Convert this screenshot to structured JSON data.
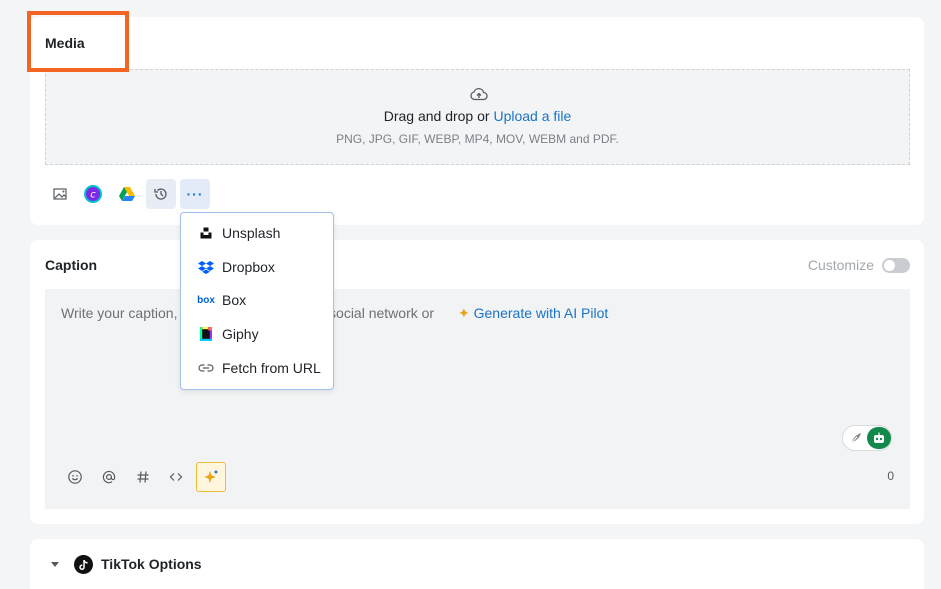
{
  "media": {
    "title": "Media",
    "dropzone": {
      "prefix": "Drag and drop or ",
      "link": "Upload a file",
      "formats": "PNG, JPG, GIF, WEBP, MP4, MOV, WEBM and PDF."
    },
    "sources": [
      "image-library-icon",
      "canva-icon",
      "google-drive-icon",
      "history-icon",
      "more-icon"
    ],
    "more_label": "···"
  },
  "more_menu": {
    "items": [
      {
        "label": "Unsplash",
        "icon": "unsplash-icon"
      },
      {
        "label": "Dropbox",
        "icon": "dropbox-icon"
      },
      {
        "label": "Box",
        "icon": "box-icon"
      },
      {
        "label": "Giphy",
        "icon": "giphy-icon"
      },
      {
        "label": "Fetch from URL",
        "icon": "link-icon"
      }
    ]
  },
  "caption": {
    "title": "Caption",
    "customize_label": "Customize",
    "customize_enabled": false,
    "placeholder": "Write your caption,",
    "placeholder_rest": "th social network or",
    "generate_spark": "✦",
    "generate_label": "Generate with AI Pilot",
    "char_count": "0",
    "tools": [
      "emoji-icon",
      "mention-icon",
      "hashtag-icon",
      "code-icon",
      "ai-sparkle-icon"
    ]
  },
  "tiktok": {
    "title": "TikTok Options"
  },
  "colors": {
    "accent": "#1a73c8",
    "highlight": "#f26522",
    "bot_green": "#128a4c"
  }
}
